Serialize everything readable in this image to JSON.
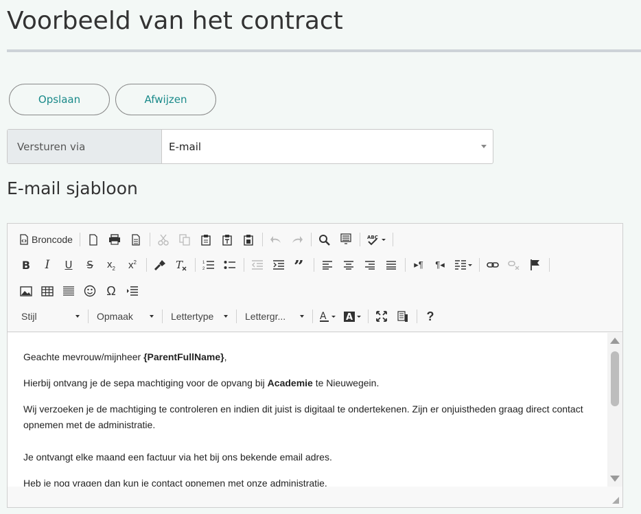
{
  "page": {
    "title": "Voorbeeld van het contract"
  },
  "buttons": {
    "save": "Opslaan",
    "reject": "Afwijzen"
  },
  "send": {
    "label": "Versturen via",
    "value": "E-mail"
  },
  "template": {
    "title": "E-mail sjabloon"
  },
  "toolbar": {
    "source_label": "Broncode",
    "style_combo": "Stijl",
    "format_combo": "Opmaak",
    "font_combo": "Lettertype",
    "size_combo": "Lettergr...",
    "help": "?"
  },
  "email": {
    "greeting_prefix": "Geachte mevrouw/mijnheer ",
    "greeting_placeholder": "{ParentFullName}",
    "greeting_suffix": ",",
    "line2_prefix": "Hierbij ontvang je de sepa machtiging voor de opvang bij ",
    "line2_org": "Academie",
    "line2_suffix": " te Nieuwegein.",
    "line3": "Wij verzoeken je de machtiging te controleren en indien dit juist is digitaal te ondertekenen. Zijn er onjuistheden graag direct contact opnemen met de administratie.",
    "line4": "Je ontvangt elke maand een factuur via het bij ons bekende email adres.",
    "line5": "Heb je nog vragen dan kun je contact opnemen met onze administratie."
  },
  "colors": {
    "accent": "#1a8a8a",
    "background": "#f3f8f6",
    "label_bg": "#e7ebed"
  }
}
